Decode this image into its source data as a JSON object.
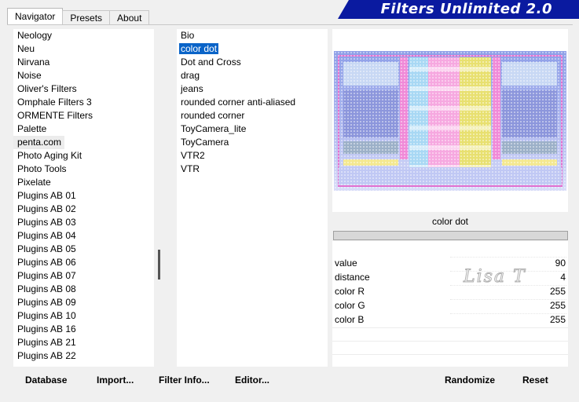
{
  "tabs": [
    {
      "label": "Navigator",
      "active": true
    },
    {
      "label": "Presets",
      "active": false
    },
    {
      "label": "About",
      "active": false
    }
  ],
  "banner_title": "Filters Unlimited 2.0",
  "categories": [
    "Neology",
    "Neu",
    "Nirvana",
    "Noise",
    "Oliver's Filters",
    "Omphale Filters 3",
    "ORMENTE Filters",
    "Palette",
    "penta.com",
    "Photo Aging Kit",
    "Photo Tools",
    "Pixelate",
    "Plugins AB 01",
    "Plugins AB 02",
    "Plugins AB 03",
    "Plugins AB 04",
    "Plugins AB 05",
    "Plugins AB 06",
    "Plugins AB 07",
    "Plugins AB 08",
    "Plugins AB 09",
    "Plugins AB 10",
    "Plugins AB 16",
    "Plugins AB 21",
    "Plugins AB 22"
  ],
  "selected_category": "penta.com",
  "filters": [
    "Bio",
    "color dot",
    "Dot and Cross",
    "drag",
    "jeans",
    "rounded corner anti-aliased",
    "rounded corner",
    "ToyCamera_lite",
    "ToyCamera",
    "VTR2",
    "VTR"
  ],
  "selected_filter": "color dot",
  "filter_name": "color dot",
  "params": [
    {
      "label": "value",
      "value": "90"
    },
    {
      "label": "distance",
      "value": "4"
    },
    {
      "label": "color R",
      "value": "255"
    },
    {
      "label": "color G",
      "value": "255"
    },
    {
      "label": "color B",
      "value": "255"
    }
  ],
  "watermark": "Lisa T",
  "buttons": {
    "database": "Database",
    "import": "Import...",
    "filter_info": "Filter Info...",
    "editor": "Editor...",
    "randomize": "Randomize",
    "reset": "Reset"
  }
}
